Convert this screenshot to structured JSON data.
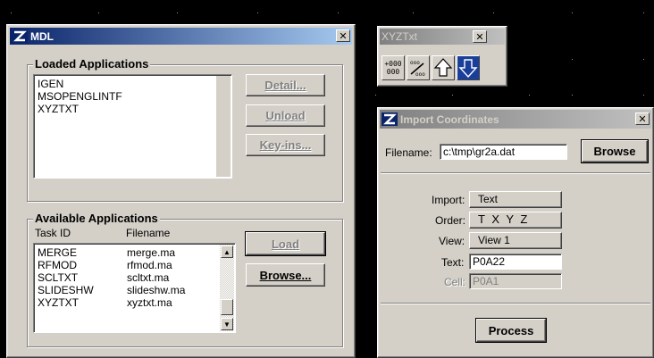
{
  "mdl_dialog": {
    "title": "MDL",
    "loaded_group_label": "Loaded Applications",
    "loaded_apps": [
      "IGEN",
      "MSOPENGLINTF",
      "XYZTXT"
    ],
    "detail_button": "Detail...",
    "unload_button": "Unload",
    "keyins_button": "Key-ins...",
    "available_group_label": "Available Applications",
    "col_task_id": "Task ID",
    "col_filename": "Filename",
    "available_apps": [
      {
        "task": "MERGE",
        "file": "merge.ma"
      },
      {
        "task": "RFMOD",
        "file": "rfmod.ma"
      },
      {
        "task": "SCLTXT",
        "file": "scltxt.ma"
      },
      {
        "task": "SLIDESHW",
        "file": "slideshw.ma"
      },
      {
        "task": "XYZTXT",
        "file": "xyztxt.ma"
      }
    ],
    "load_button": "Load",
    "browse_button": "Browse..."
  },
  "xyz_toolbox": {
    "title": "XYZTxt",
    "tools": [
      "export-coordinates-icon",
      "import-coordinates-icon",
      "up-arrow-icon",
      "down-arrow-icon"
    ],
    "tool1_text": [
      "+000",
      "000"
    ]
  },
  "import_dialog": {
    "title": "Import Coordinates",
    "filename_label": "Filename:",
    "filename_value": "c:\\tmp\\gr2a.dat",
    "browse_button": "Browse",
    "import_label": "Import:",
    "import_value": "Text",
    "order_label": "Order:",
    "order_value": "T X Y Z",
    "view_label": "View:",
    "view_value": "View 1",
    "text_label": "Text:",
    "text_value": "P0A22",
    "cell_label": "Cell:",
    "cell_value": "P0A1",
    "process_button": "Process"
  },
  "colors": {
    "desktop": "#000000",
    "dialog_face": "#d4d0c8",
    "active_title": "#0a246a",
    "inactive_title": "#808080"
  }
}
